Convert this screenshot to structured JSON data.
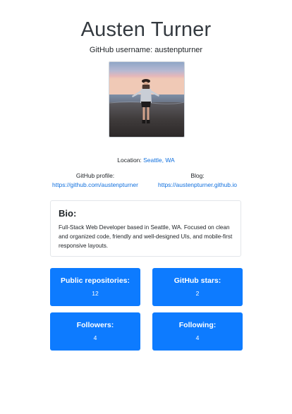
{
  "profile": {
    "name": "Austen Turner",
    "username_line": "GitHub username: austenpturner",
    "location_label": "Location:",
    "location_value": "Seattle, WA"
  },
  "links": {
    "profile_label": "GitHub profile:",
    "profile_url": "https://github.com/austenpturner",
    "blog_label": "Blog:",
    "blog_url": "https://austenpturner.github.io"
  },
  "bio": {
    "title": "Bio:",
    "text": "Full-Stack Web Developer based in Seattle, WA. Focused on clean and organized code, friendly and well-designed UIs, and mobile-first responsive layouts."
  },
  "stats": [
    {
      "label": "Public repositories:",
      "value": "12"
    },
    {
      "label": "GitHub stars:",
      "value": "2"
    },
    {
      "label": "Followers:",
      "value": "4"
    },
    {
      "label": "Following:",
      "value": "4"
    }
  ],
  "colors": {
    "accent": "#0d7bff",
    "link": "#0f6fde"
  }
}
